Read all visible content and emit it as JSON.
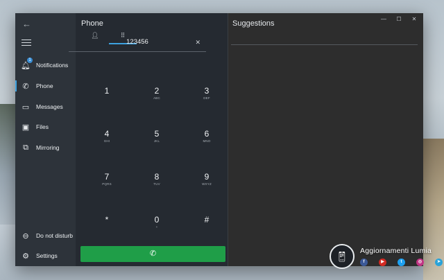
{
  "sidebar": {
    "back_icon": "back-arrow-icon",
    "menu_icon": "hamburger-icon",
    "items": [
      {
        "label": "Notifications",
        "icon": "bell-icon",
        "badge": "1"
      },
      {
        "label": "Phone",
        "icon": "phone-icon",
        "active": true
      },
      {
        "label": "Messages",
        "icon": "chat-icon"
      },
      {
        "label": "Files",
        "icon": "photo-icon"
      },
      {
        "label": "Mirroring",
        "icon": "mirroring-icon"
      }
    ],
    "bottom_items": [
      {
        "label": "Do not disturb",
        "icon": "minus-circle-icon"
      },
      {
        "label": "Settings",
        "icon": "gear-icon"
      }
    ]
  },
  "phone": {
    "title": "Phone",
    "tabs": [
      {
        "icon": "contact-icon"
      },
      {
        "icon": "dialpad-icon",
        "active": true
      }
    ],
    "dialed_number": "123456",
    "clear_icon": "close-icon",
    "keys": [
      {
        "digit": "1",
        "letters": ""
      },
      {
        "digit": "2",
        "letters": "ABC"
      },
      {
        "digit": "3",
        "letters": "DEF"
      },
      {
        "digit": "4",
        "letters": "GHI"
      },
      {
        "digit": "5",
        "letters": "JKL"
      },
      {
        "digit": "6",
        "letters": "MNO"
      },
      {
        "digit": "7",
        "letters": "PQRS"
      },
      {
        "digit": "8",
        "letters": "TUV"
      },
      {
        "digit": "9",
        "letters": "WXYZ"
      },
      {
        "digit": "*",
        "letters": ""
      },
      {
        "digit": "0",
        "letters": "+"
      },
      {
        "digit": "#",
        "letters": ""
      }
    ],
    "call_icon": "phone-call-icon",
    "call_color": "#1f9e48"
  },
  "suggestions": {
    "title": "Suggestions"
  },
  "window_controls": [
    "minimize-icon",
    "maximize-icon",
    "close-icon"
  ],
  "watermark": {
    "name": "Aggiornamenti Lumia",
    "social_icons": [
      "facebook-icon",
      "youtube-icon",
      "twitter-icon",
      "instagram-icon",
      "telegram-icon"
    ]
  },
  "colors": {
    "accent": "#3da2e0",
    "call_green": "#1f9e48"
  }
}
